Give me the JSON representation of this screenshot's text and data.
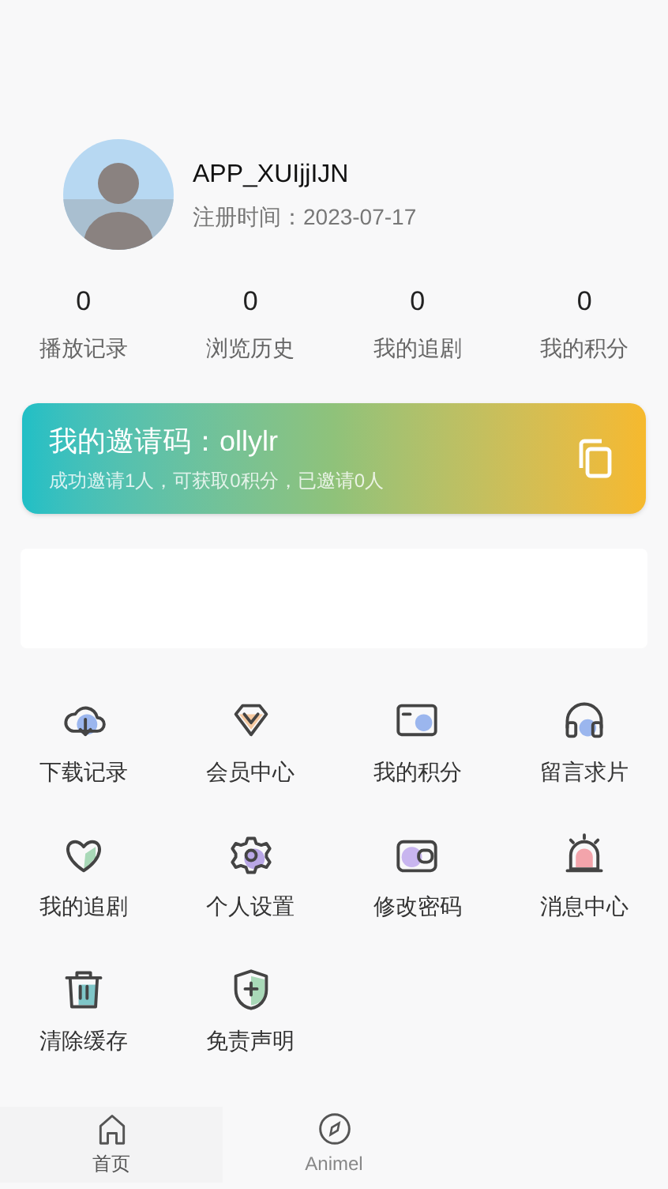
{
  "profile": {
    "username": "APP_XUIjjIJN",
    "registered": "注册时间：2023-07-17"
  },
  "stats": [
    {
      "value": "0",
      "label": "播放记录"
    },
    {
      "value": "0",
      "label": "浏览历史"
    },
    {
      "value": "0",
      "label": "我的追剧"
    },
    {
      "value": "0",
      "label": "我的积分"
    }
  ],
  "invite": {
    "title": "我的邀请码：ollylr",
    "summary": "成功邀请1人，可获取0积分，已邀请0人"
  },
  "menu": [
    {
      "kind": "cloud",
      "label": "下载记录"
    },
    {
      "kind": "vip",
      "label": "会员中心"
    },
    {
      "kind": "card",
      "label": "我的积分"
    },
    {
      "kind": "headset",
      "label": "留言求片"
    },
    {
      "kind": "heart",
      "label": "我的追剧"
    },
    {
      "kind": "gear",
      "label": "个人设置"
    },
    {
      "kind": "wallet",
      "label": "修改密码"
    },
    {
      "kind": "alarm",
      "label": "消息中心"
    },
    {
      "kind": "trash",
      "label": "清除缓存"
    },
    {
      "kind": "shield",
      "label": "免责声明"
    }
  ],
  "bottom_nav": [
    {
      "kind": "home",
      "label": "首页",
      "selected": true
    },
    {
      "kind": "compass",
      "label": "Animel",
      "selected": false
    }
  ]
}
